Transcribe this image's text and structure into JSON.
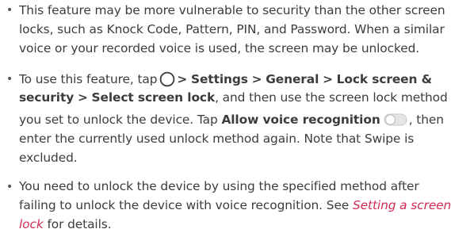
{
  "bullets": [
    {
      "lines": [
        "This feature may be more vulnerable to security than the other screen",
        "locks, such as Knock Code, Pattern, PIN, and Password. When a similar",
        "voice or your recorded voice is used, the screen may be unlocked."
      ]
    },
    {
      "l1_pre": "To use this feature, tap",
      "sep": ">",
      "settings": "Settings",
      "general": "General",
      "lock_screen_security_1": "Lock screen &",
      "lock_screen_security_2": "security",
      "select_screen_lock": "Select screen lock",
      "l2_post": ", and then use the screen lock method",
      "l3": "you set to unlock the device. Tap",
      "allow_voice": "Allow voice recognition",
      "l3_post": ", then",
      "l4": "enter the currently used unlock method again. Note that Swipe is",
      "l5": "excluded."
    },
    {
      "l1": "You need to unlock the device by using the specified method after",
      "l2_pre": "failing to unlock the device with voice recognition. See",
      "link_1": "Setting a screen",
      "link_2": "lock",
      "l3_post": "for details."
    }
  ],
  "bullet_char": "•",
  "colors": {
    "text": "#3c3c3c",
    "link": "#d02a55"
  },
  "icons": {
    "home": "home-circle-icon",
    "toggle": "toggle-off-icon"
  }
}
